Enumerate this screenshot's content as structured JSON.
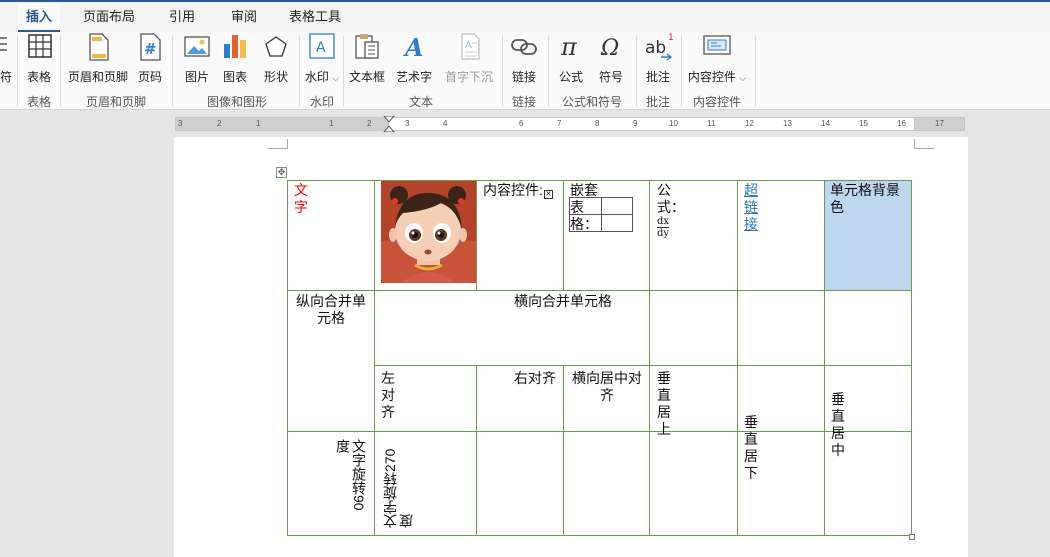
{
  "tabs": [
    "插入",
    "页面布局",
    "引用",
    "审阅",
    "表格工具"
  ],
  "active_tab": "插入",
  "ribbon": {
    "partial_left_label": "符",
    "buttons": {
      "table": "表格",
      "header_footer": "页眉和页脚",
      "page_number": "页码",
      "picture": "图片",
      "chart": "图表",
      "shape": "形状",
      "watermark": "水印",
      "textbox": "文本框",
      "wordart": "艺术字",
      "dropcap": "首字下沉",
      "link": "链接",
      "equation": "公式",
      "symbol": "符号",
      "comment": "批注",
      "content_control": "内容控件"
    },
    "groups": {
      "table": "表格",
      "header_footer": "页眉和页脚",
      "images": "图像和图形",
      "watermark": "水印",
      "text": "文本",
      "link": "链接",
      "equation_symbol": "公式和符号",
      "comment": "批注",
      "content_control": "内容控件"
    }
  },
  "ruler": {
    "ticks": [
      "3",
      "2",
      "1",
      "1",
      "2",
      "3",
      "4",
      "6",
      "7",
      "8",
      "9",
      "10",
      "11",
      "12",
      "13",
      "14",
      "15",
      "16",
      "17"
    ]
  },
  "table": {
    "r1": {
      "text": "文字",
      "content_control": "内容控件:",
      "nested_table": "嵌套表格：",
      "formula": "公式：",
      "formula_num": "dx",
      "formula_den": "dy",
      "hyperlink": "超链接",
      "shaded": "单元格背景色"
    },
    "r2": {
      "vmerge": "纵向合并单元格",
      "hmerge": "横向合并单元格"
    },
    "r3": {
      "left": "左对齐",
      "right": "右对齐",
      "center": "横向居中对齐",
      "top": "垂直居上",
      "bottom": "垂直居下",
      "middle": "垂直居中"
    },
    "r4": {
      "rot90": "文字旋转90度",
      "rot270": "文字旋转270度"
    }
  },
  "colors": {
    "accent": "#2b579a",
    "red_text": "#ff0000",
    "link": "#2e75b6",
    "shade": "#bdd7ee",
    "border": "#6b9a52"
  }
}
